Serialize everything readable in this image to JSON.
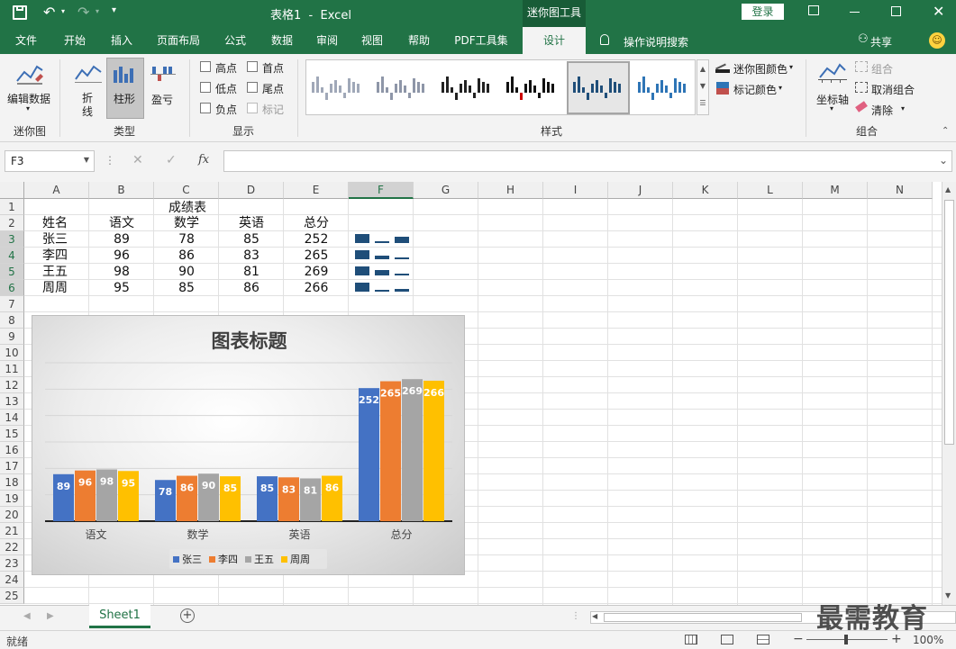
{
  "window": {
    "title": "表格1  -  Excel",
    "context_tool": "迷你图工具",
    "login_label": "登录"
  },
  "tabs": [
    "文件",
    "开始",
    "插入",
    "页面布局",
    "公式",
    "数据",
    "审阅",
    "视图",
    "帮助",
    "PDF工具集",
    "设计"
  ],
  "active_tab": "设计",
  "tell_me": "操作说明搜索",
  "share_label": "共享",
  "ribbon": {
    "sparkline": {
      "edit_data": "编辑数据",
      "group": "迷你图"
    },
    "type": {
      "line": "折\n线",
      "column": "柱形",
      "winloss": "盈亏",
      "group": "类型"
    },
    "show": {
      "high": "高点",
      "low": "低点",
      "negative": "负点",
      "first": "首点",
      "last": "尾点",
      "markers": "标记",
      "group": "显示"
    },
    "style": {
      "group": "样式",
      "color": "迷你图颜色",
      "marker_color": "标记颜色"
    },
    "grouping": {
      "axis": "坐标轴",
      "group_btn": "组合",
      "ungroup": "取消组合",
      "clear": "清除",
      "group": "组合"
    }
  },
  "formula": {
    "name_box": "F3",
    "fx": "fx",
    "value": ""
  },
  "columns": [
    "A",
    "B",
    "C",
    "D",
    "E",
    "F",
    "G",
    "H",
    "I",
    "J",
    "K",
    "L",
    "M",
    "N"
  ],
  "rows": [
    "1",
    "2",
    "3",
    "4",
    "5",
    "6",
    "7",
    "8",
    "9",
    "10",
    "11",
    "12",
    "13",
    "14",
    "15",
    "16",
    "17",
    "18",
    "19",
    "20",
    "21",
    "22",
    "23",
    "24",
    "25"
  ],
  "sheet": {
    "title": "成绩表",
    "headers": [
      "姓名",
      "语文",
      "数学",
      "英语",
      "总分"
    ],
    "data": [
      [
        "张三",
        "89",
        "78",
        "85",
        "252"
      ],
      [
        "李四",
        "96",
        "86",
        "83",
        "265"
      ],
      [
        "王五",
        "98",
        "90",
        "81",
        "269"
      ],
      [
        "周周",
        "95",
        "85",
        "86",
        "266"
      ]
    ]
  },
  "chart_data": {
    "type": "bar",
    "title": "图表标题",
    "categories": [
      "语文",
      "数学",
      "英语",
      "总分"
    ],
    "series": [
      {
        "name": "张三",
        "values": [
          89,
          78,
          85,
          252
        ],
        "color": "#4472c4"
      },
      {
        "name": "李四",
        "values": [
          96,
          86,
          83,
          265
        ],
        "color": "#ed7d31"
      },
      {
        "name": "王五",
        "values": [
          98,
          90,
          81,
          269
        ],
        "color": "#a5a5a5"
      },
      {
        "name": "周周",
        "values": [
          95,
          85,
          86,
          266
        ],
        "color": "#ffc000"
      }
    ],
    "ylim": [
      0,
      300
    ],
    "grid": true,
    "legend": "bottom"
  },
  "sheet_tabs": [
    "Sheet1"
  ],
  "status": {
    "mode": "就绪",
    "zoom": "100%"
  },
  "watermark": "最需教育"
}
